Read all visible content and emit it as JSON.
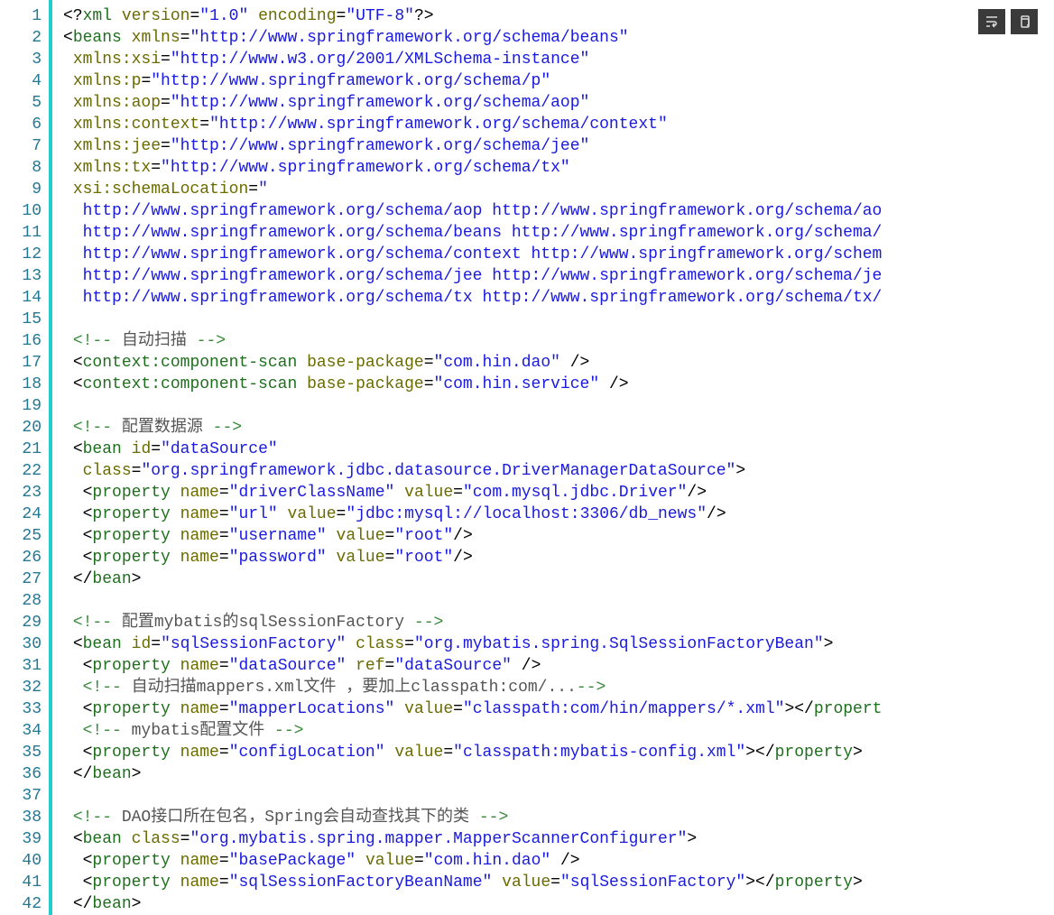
{
  "gutter": {
    "start": 1,
    "end": 42
  },
  "toolbar": {
    "btn1_name": "wrap-icon",
    "btn2_name": "copy-icon"
  },
  "code": {
    "lines": [
      {
        "n": 1,
        "html": "<span class='p'>&lt;?</span><span class='t'>xml</span><span class='p'> </span><span class='a'>version</span><span class='p'>=</span><span class='s'>\"1.0\"</span><span class='p'> </span><span class='a'>encoding</span><span class='p'>=</span><span class='s'>\"UTF-8\"</span><span class='p'>?&gt;</span>"
      },
      {
        "n": 2,
        "html": "<span class='p'>&lt;</span><span class='t'>beans</span><span class='p'> </span><span class='a'>xmlns</span><span class='p'>=</span><span class='s'>\"http://www.springframework.org/schema/beans\"</span>"
      },
      {
        "n": 3,
        "html": "<span class='p'> </span><span class='a'>xmlns:xsi</span><span class='p'>=</span><span class='s'>\"http://www.w3.org/2001/XMLSchema-instance\"</span>"
      },
      {
        "n": 4,
        "html": "<span class='p'> </span><span class='a'>xmlns:p</span><span class='p'>=</span><span class='s'>\"http://www.springframework.org/schema/p\"</span>"
      },
      {
        "n": 5,
        "html": "<span class='p'> </span><span class='a'>xmlns:aop</span><span class='p'>=</span><span class='s'>\"http://www.springframework.org/schema/aop\"</span>"
      },
      {
        "n": 6,
        "html": "<span class='p'> </span><span class='a'>xmlns:context</span><span class='p'>=</span><span class='s'>\"http://www.springframework.org/schema/context\"</span>"
      },
      {
        "n": 7,
        "html": "<span class='p'> </span><span class='a'>xmlns:jee</span><span class='p'>=</span><span class='s'>\"http://www.springframework.org/schema/jee\"</span>"
      },
      {
        "n": 8,
        "html": "<span class='p'> </span><span class='a'>xmlns:tx</span><span class='p'>=</span><span class='s'>\"http://www.springframework.org/schema/tx\"</span>"
      },
      {
        "n": 9,
        "html": "<span class='p'> </span><span class='a'>xsi:schemaLocation</span><span class='p'>=</span><span class='s'>\"</span>"
      },
      {
        "n": 10,
        "html": "<span class='s'>  http://www.springframework.org/schema/aop http://www.springframework.org/schema/ao</span>"
      },
      {
        "n": 11,
        "html": "<span class='s'>  http://www.springframework.org/schema/beans http://www.springframework.org/schema/</span>"
      },
      {
        "n": 12,
        "html": "<span class='s'>  http://www.springframework.org/schema/context http://www.springframework.org/schem</span>"
      },
      {
        "n": 13,
        "html": "<span class='s'>  http://www.springframework.org/schema/jee http://www.springframework.org/schema/je</span>"
      },
      {
        "n": 14,
        "html": "<span class='s'>  http://www.springframework.org/schema/tx http://www.springframework.org/schema/tx/</span>"
      },
      {
        "n": 15,
        "html": ""
      },
      {
        "n": 16,
        "html": " <span class='cg'>&lt;!--</span><span class='c'> 自动扫描 </span><span class='cg'>--&gt;</span>"
      },
      {
        "n": 17,
        "html": " <span class='p'>&lt;</span><span class='t'>context:component-scan</span><span class='p'> </span><span class='a'>base-package</span><span class='p'>=</span><span class='s'>\"com.hin.dao\"</span><span class='p'> /&gt;</span>"
      },
      {
        "n": 18,
        "html": " <span class='p'>&lt;</span><span class='t'>context:component-scan</span><span class='p'> </span><span class='a'>base-package</span><span class='p'>=</span><span class='s'>\"com.hin.service\"</span><span class='p'> /&gt;</span>"
      },
      {
        "n": 19,
        "html": ""
      },
      {
        "n": 20,
        "html": " <span class='cg'>&lt;!--</span><span class='c'> 配置数据源 </span><span class='cg'>--&gt;</span>"
      },
      {
        "n": 21,
        "html": " <span class='p'>&lt;</span><span class='t'>bean</span><span class='p'> </span><span class='a'>id</span><span class='p'>=</span><span class='s'>\"dataSource\"</span>"
      },
      {
        "n": 22,
        "html": "  <span class='a'>class</span><span class='p'>=</span><span class='s'>\"org.springframework.jdbc.datasource.DriverManagerDataSource\"</span><span class='p'>&gt;</span>"
      },
      {
        "n": 23,
        "html": "  <span class='p'>&lt;</span><span class='t'>property</span><span class='p'> </span><span class='a'>name</span><span class='p'>=</span><span class='s'>\"driverClassName\"</span><span class='p'> </span><span class='a'>value</span><span class='p'>=</span><span class='s'>\"com.mysql.jdbc.Driver\"</span><span class='p'>/&gt;</span>"
      },
      {
        "n": 24,
        "html": "  <span class='p'>&lt;</span><span class='t'>property</span><span class='p'> </span><span class='a'>name</span><span class='p'>=</span><span class='s'>\"url\"</span><span class='p'> </span><span class='a'>value</span><span class='p'>=</span><span class='s'>\"jdbc:mysql://localhost:3306/db_news\"</span><span class='p'>/&gt;</span>"
      },
      {
        "n": 25,
        "html": "  <span class='p'>&lt;</span><span class='t'>property</span><span class='p'> </span><span class='a'>name</span><span class='p'>=</span><span class='s'>\"username\"</span><span class='p'> </span><span class='a'>value</span><span class='p'>=</span><span class='s'>\"root\"</span><span class='p'>/&gt;</span>"
      },
      {
        "n": 26,
        "html": "  <span class='p'>&lt;</span><span class='t'>property</span><span class='p'> </span><span class='a'>name</span><span class='p'>=</span><span class='s'>\"password\"</span><span class='p'> </span><span class='a'>value</span><span class='p'>=</span><span class='s'>\"root\"</span><span class='p'>/&gt;</span>"
      },
      {
        "n": 27,
        "html": " <span class='p'>&lt;/</span><span class='t'>bean</span><span class='p'>&gt;</span>"
      },
      {
        "n": 28,
        "html": ""
      },
      {
        "n": 29,
        "html": " <span class='cg'>&lt;!--</span><span class='c'> 配置mybatis的sqlSessionFactory </span><span class='cg'>--&gt;</span>"
      },
      {
        "n": 30,
        "html": " <span class='p'>&lt;</span><span class='t'>bean</span><span class='p'> </span><span class='a'>id</span><span class='p'>=</span><span class='s'>\"sqlSessionFactory\"</span><span class='p'> </span><span class='a'>class</span><span class='p'>=</span><span class='s'>\"org.mybatis.spring.SqlSessionFactoryBean\"</span><span class='p'>&gt;</span>"
      },
      {
        "n": 31,
        "html": "  <span class='p'>&lt;</span><span class='t'>property</span><span class='p'> </span><span class='a'>name</span><span class='p'>=</span><span class='s'>\"dataSource\"</span><span class='p'> </span><span class='a'>ref</span><span class='p'>=</span><span class='s'>\"dataSource\"</span><span class='p'> /&gt;</span>"
      },
      {
        "n": 32,
        "html": "  <span class='cg'>&lt;!--</span><span class='c'> 自动扫描mappers.xml文件 ，要加上classpath:com/...</span><span class='cg'>--&gt;</span>"
      },
      {
        "n": 33,
        "html": "  <span class='p'>&lt;</span><span class='t'>property</span><span class='p'> </span><span class='a'>name</span><span class='p'>=</span><span class='s'>\"mapperLocations\"</span><span class='p'> </span><span class='a'>value</span><span class='p'>=</span><span class='s'>\"classpath:com/hin/mappers/*.xml\"</span><span class='p'>&gt;&lt;/</span><span class='t'>propert</span>"
      },
      {
        "n": 34,
        "html": "  <span class='cg'>&lt;!--</span><span class='c'> mybatis配置文件 </span><span class='cg'>--&gt;</span>"
      },
      {
        "n": 35,
        "html": "  <span class='p'>&lt;</span><span class='t'>property</span><span class='p'> </span><span class='a'>name</span><span class='p'>=</span><span class='s'>\"configLocation\"</span><span class='p'> </span><span class='a'>value</span><span class='p'>=</span><span class='s'>\"classpath:mybatis-config.xml\"</span><span class='p'>&gt;&lt;/</span><span class='t'>property</span><span class='p'>&gt;</span>"
      },
      {
        "n": 36,
        "html": " <span class='p'>&lt;/</span><span class='t'>bean</span><span class='p'>&gt;</span>"
      },
      {
        "n": 37,
        "html": ""
      },
      {
        "n": 38,
        "html": " <span class='cg'>&lt;!--</span><span class='c'> DAO接口所在包名，Spring会自动查找其下的类 </span><span class='cg'>--&gt;</span>"
      },
      {
        "n": 39,
        "html": " <span class='p'>&lt;</span><span class='t'>bean</span><span class='p'> </span><span class='a'>class</span><span class='p'>=</span><span class='s'>\"org.mybatis.spring.mapper.MapperScannerConfigurer\"</span><span class='p'>&gt;</span>"
      },
      {
        "n": 40,
        "html": "  <span class='p'>&lt;</span><span class='t'>property</span><span class='p'> </span><span class='a'>name</span><span class='p'>=</span><span class='s'>\"basePackage\"</span><span class='p'> </span><span class='a'>value</span><span class='p'>=</span><span class='s'>\"com.hin.dao\"</span><span class='p'> /&gt;</span>"
      },
      {
        "n": 41,
        "html": "  <span class='p'>&lt;</span><span class='t'>property</span><span class='p'> </span><span class='a'>name</span><span class='p'>=</span><span class='s'>\"sqlSessionFactoryBeanName\"</span><span class='p'> </span><span class='a'>value</span><span class='p'>=</span><span class='s'>\"sqlSessionFactory\"</span><span class='p'>&gt;&lt;/</span><span class='t'>property</span><span class='p'>&gt;</span>"
      },
      {
        "n": 42,
        "html": " <span class='p'>&lt;/</span><span class='t'>bean</span><span class='p'>&gt;</span>"
      }
    ]
  }
}
